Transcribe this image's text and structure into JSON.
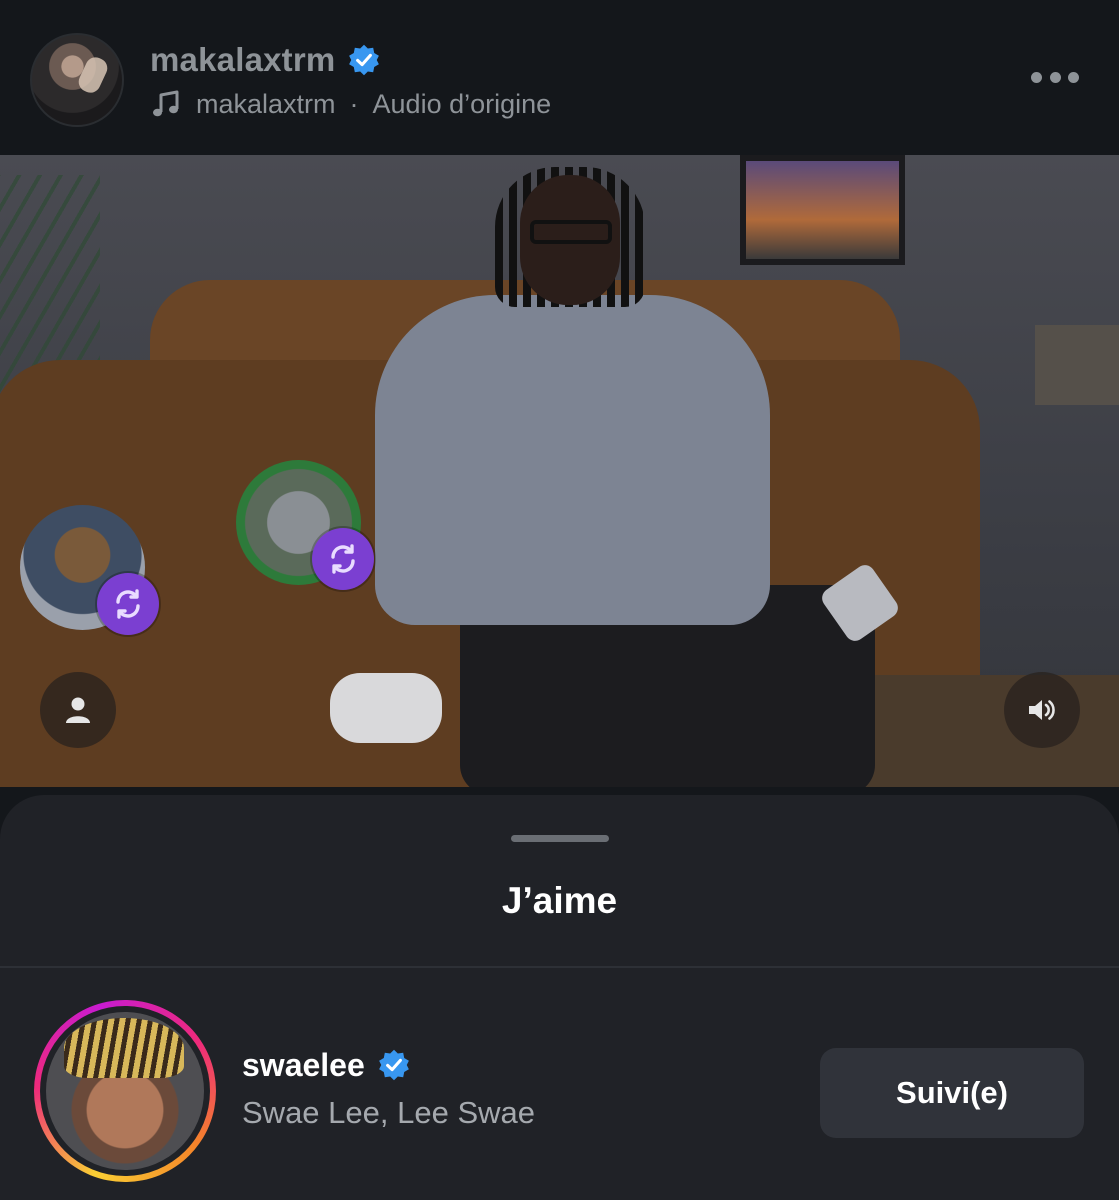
{
  "header": {
    "username": "makalaxtrm",
    "audio_owner": "makalaxtrm",
    "audio_separator": "·",
    "audio_label": "Audio d’origine",
    "icons": {
      "verified": "verified-badge-icon",
      "music": "music-note-icon",
      "more": "more-horizontal-icon"
    }
  },
  "video": {
    "controls": {
      "user_tags": "person-icon",
      "sound": "speaker-icon"
    },
    "reposter_bubbles": [
      {
        "badge_icon": "repost-icon",
        "badge_color": "#7b3fd1"
      },
      {
        "badge_icon": "repost-icon",
        "badge_color": "#7b3fd1"
      }
    ]
  },
  "likes_sheet": {
    "title": "J’aime",
    "items": [
      {
        "username": "swaelee",
        "full_name": "Swae Lee, Lee Swae",
        "verified": true,
        "has_story": true,
        "follow_label": "Suivi(e)"
      }
    ]
  },
  "colors": {
    "background": "#14171b",
    "sheet": "#202227",
    "verified_blue": "#3897f0",
    "secondary_text": "#8e9398",
    "button_bg": "#30333a"
  }
}
